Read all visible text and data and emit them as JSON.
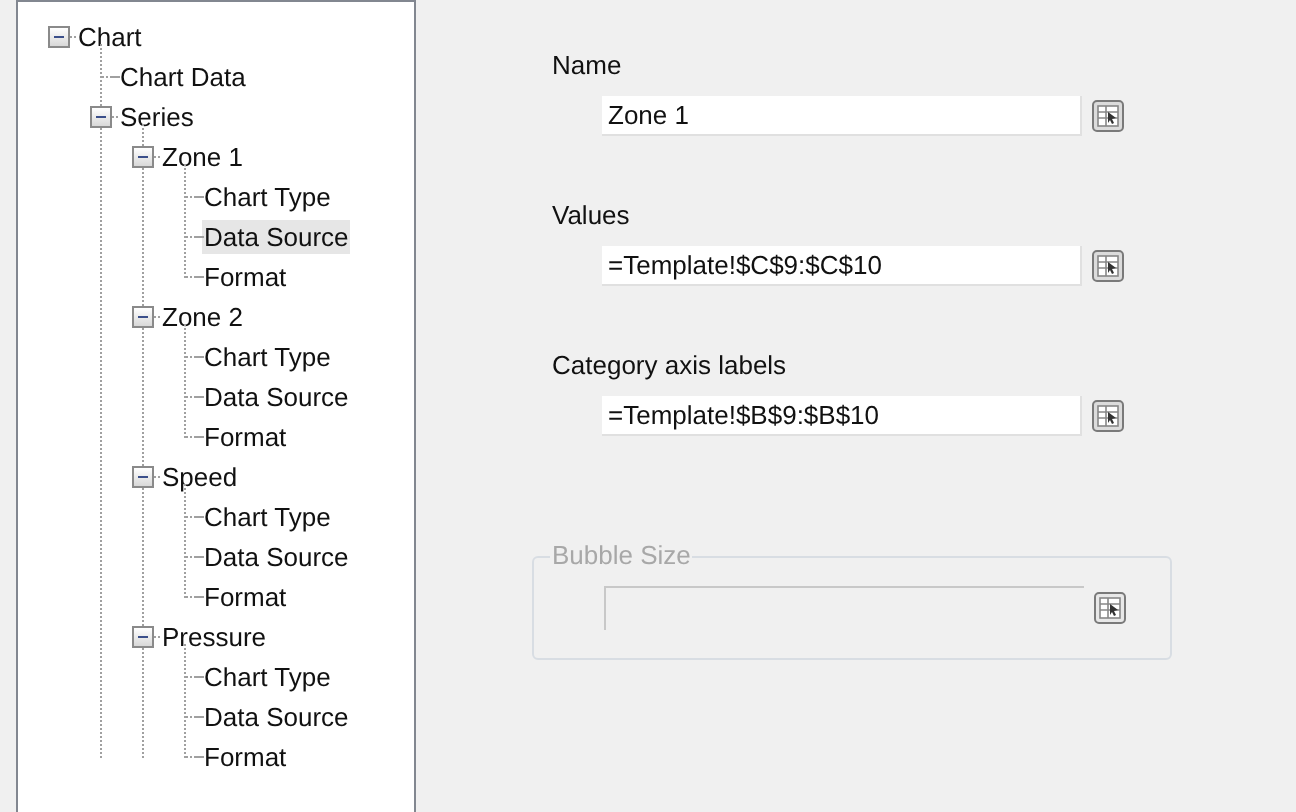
{
  "tree": [
    {
      "label": "Chart",
      "expanded": true,
      "selected": false,
      "children": [
        {
          "label": "Chart Data",
          "selected": false
        },
        {
          "label": "Series",
          "expanded": true,
          "selected": false,
          "children": [
            {
              "label": "Zone 1",
              "expanded": true,
              "selected": false,
              "children": [
                {
                  "label": "Chart Type",
                  "selected": false
                },
                {
                  "label": "Data Source",
                  "selected": true
                },
                {
                  "label": "Format",
                  "selected": false
                }
              ]
            },
            {
              "label": "Zone 2",
              "expanded": true,
              "selected": false,
              "children": [
                {
                  "label": "Chart Type",
                  "selected": false
                },
                {
                  "label": "Data Source",
                  "selected": false
                },
                {
                  "label": "Format",
                  "selected": false
                }
              ]
            },
            {
              "label": "Speed",
              "expanded": true,
              "selected": false,
              "children": [
                {
                  "label": "Chart Type",
                  "selected": false
                },
                {
                  "label": "Data Source",
                  "selected": false
                },
                {
                  "label": "Format",
                  "selected": false
                }
              ]
            },
            {
              "label": "Pressure",
              "expanded": true,
              "selected": false,
              "children": [
                {
                  "label": "Chart Type",
                  "selected": false
                },
                {
                  "label": "Data Source",
                  "selected": false
                },
                {
                  "label": "Format",
                  "selected": false
                }
              ]
            }
          ]
        }
      ]
    }
  ],
  "fields": [
    {
      "label": "Name",
      "value": "Zone 1"
    },
    {
      "label": "Values",
      "value": "=Template!$C$9:$C$10"
    },
    {
      "label": "Category axis labels",
      "value": "=Template!$B$9:$B$10"
    }
  ],
  "bubble_size": {
    "label": "Bubble Size",
    "disabled": true
  }
}
